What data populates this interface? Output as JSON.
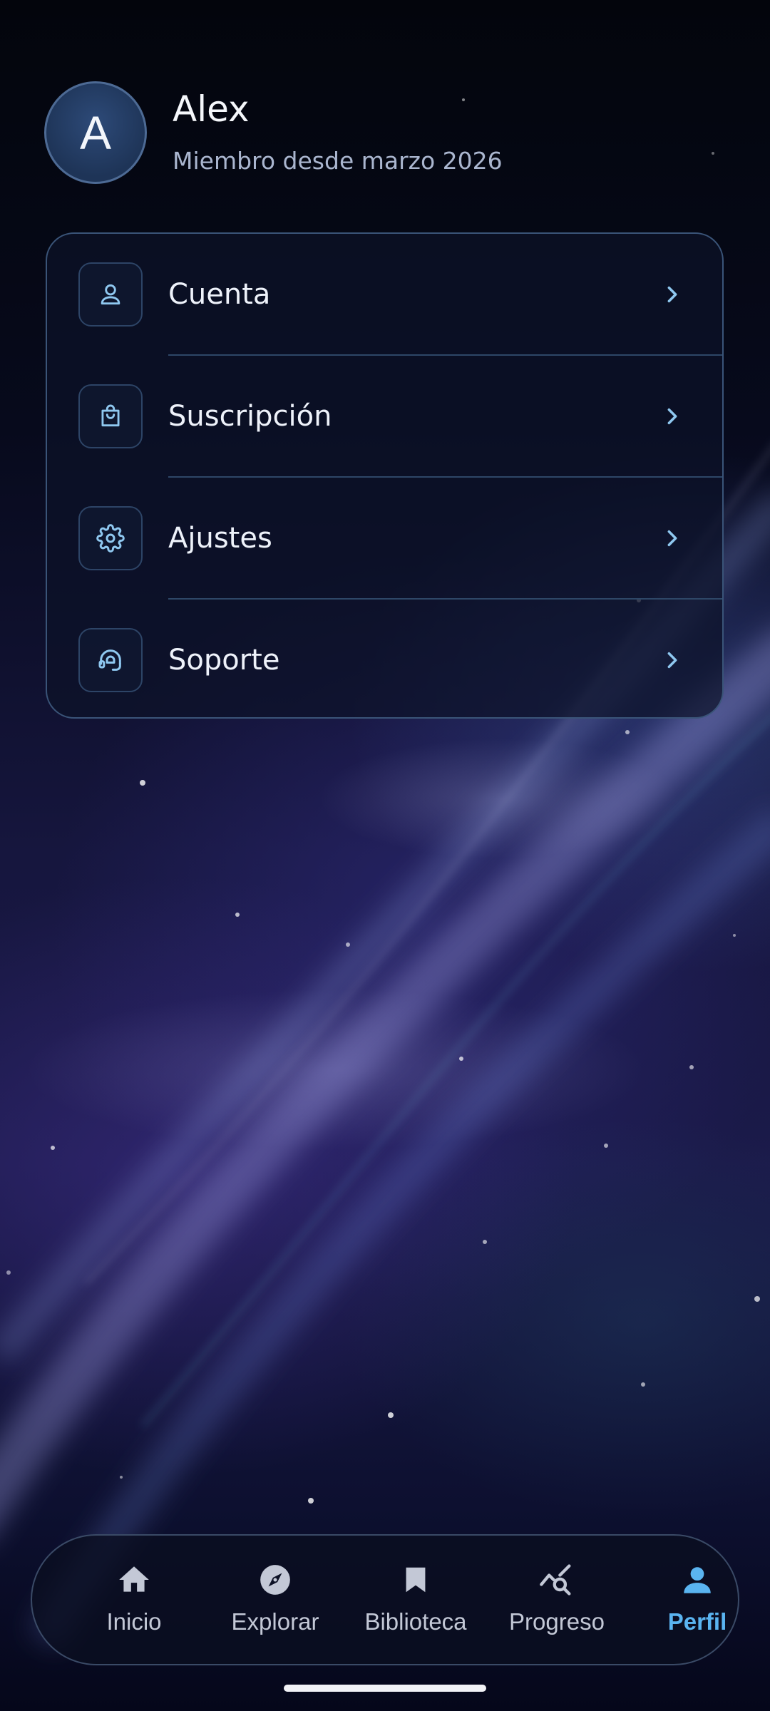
{
  "profile": {
    "avatar_initial": "A",
    "name": "Alex",
    "member_since": "Miembro desde marzo 2026"
  },
  "menu": {
    "items": [
      {
        "label": "Cuenta",
        "icon": "user-icon"
      },
      {
        "label": "Suscripción",
        "icon": "shopping-bag-icon"
      },
      {
        "label": "Ajustes",
        "icon": "gear-icon"
      },
      {
        "label": "Soporte",
        "icon": "headset-icon"
      }
    ]
  },
  "nav": {
    "items": [
      {
        "label": "Inicio",
        "icon": "home-icon"
      },
      {
        "label": "Explorar",
        "icon": "compass-icon"
      },
      {
        "label": "Biblioteca",
        "icon": "bookmark-icon"
      },
      {
        "label": "Progreso",
        "icon": "progress-search-icon"
      },
      {
        "label": "Perfil",
        "icon": "person-icon",
        "active": true
      }
    ]
  },
  "colors": {
    "accent": "#5ab4f0",
    "icon_tint": "#8fc8f0",
    "nav_inactive": "#c3c8d6"
  }
}
